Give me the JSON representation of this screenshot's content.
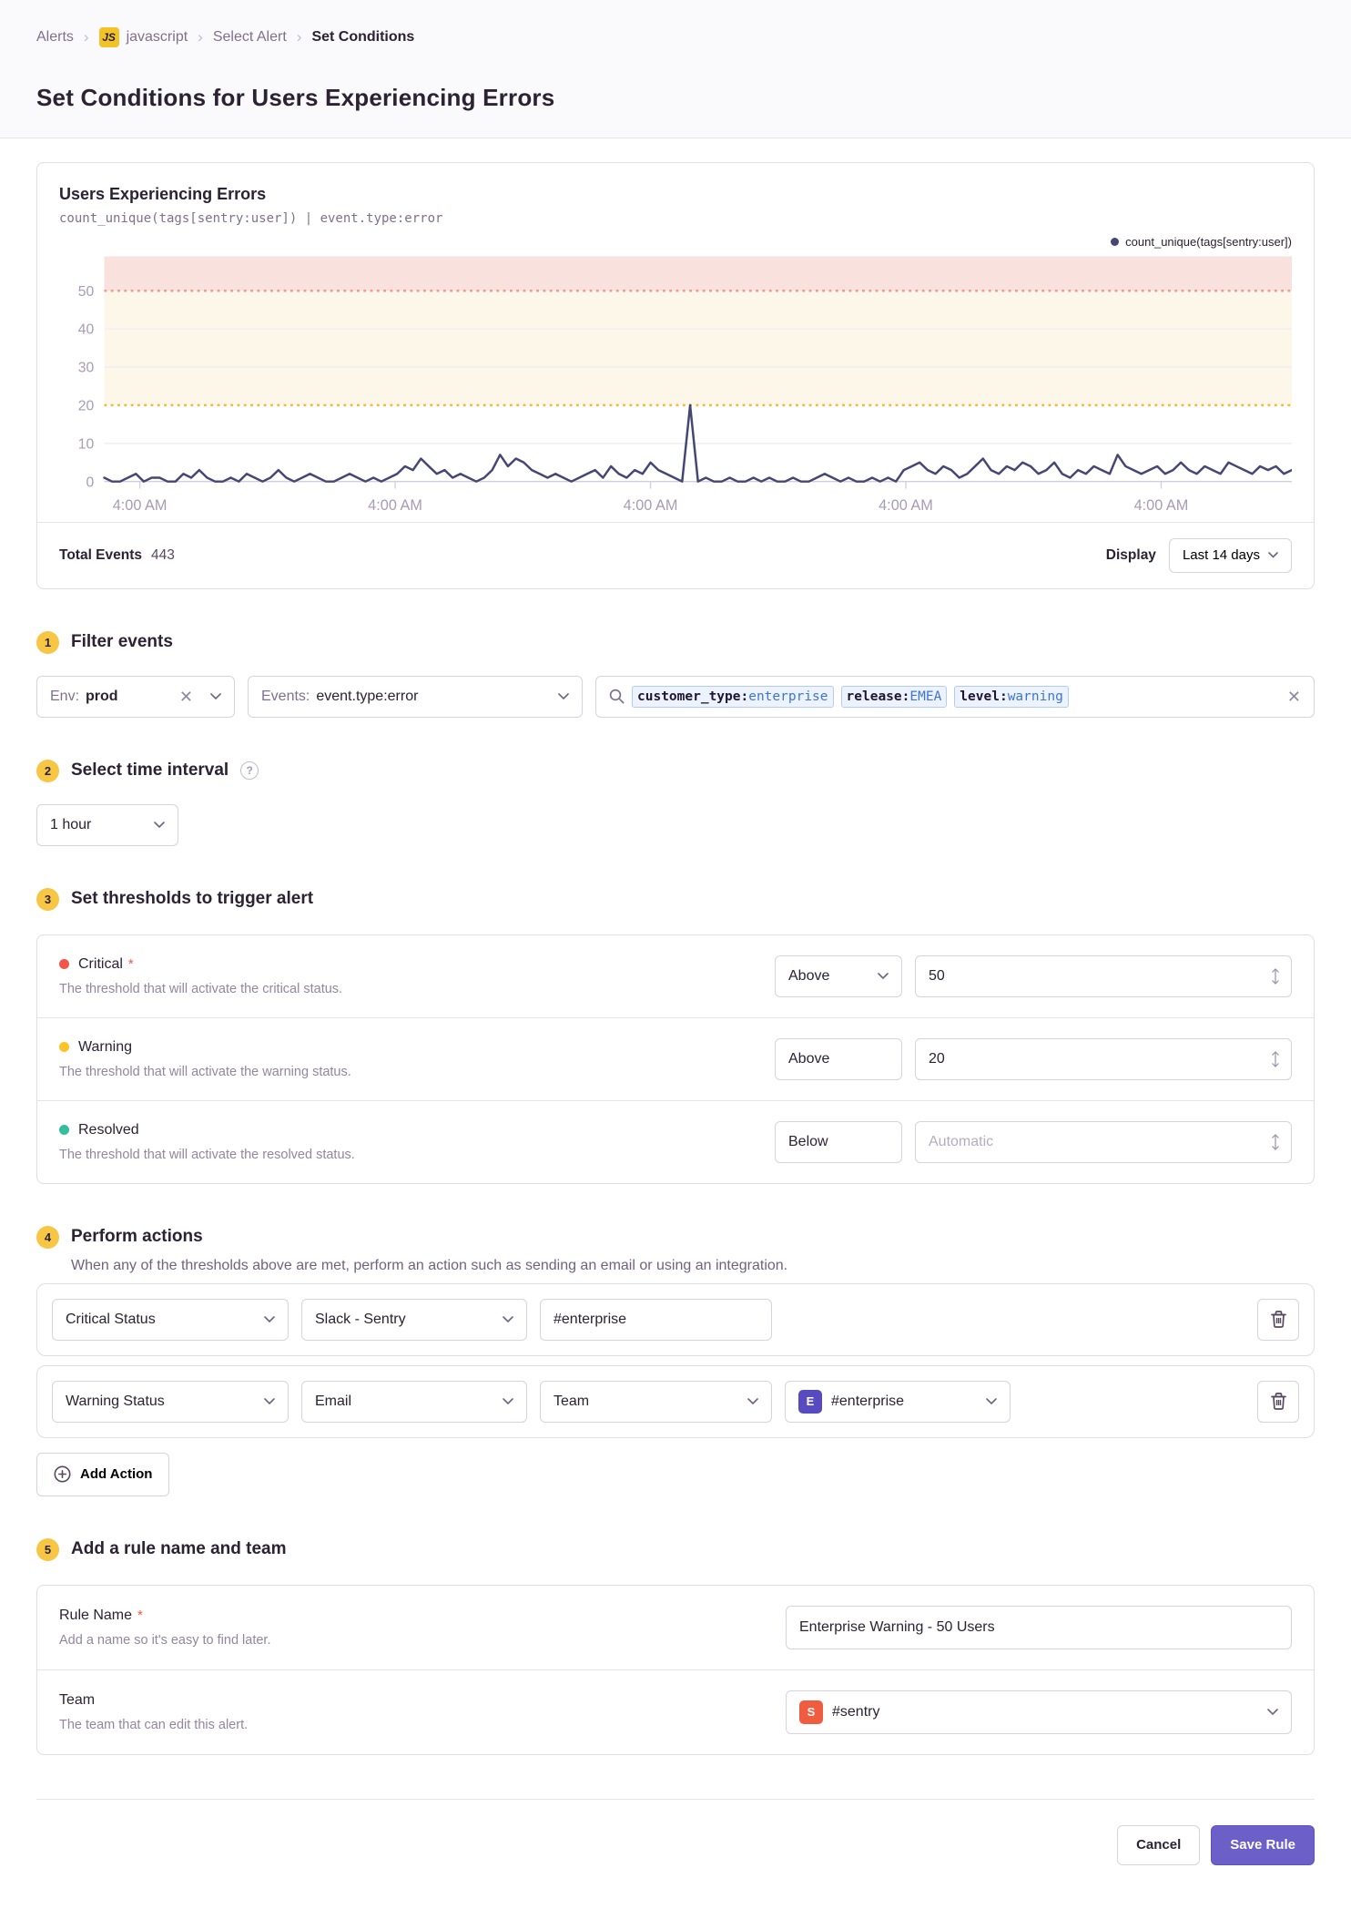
{
  "colors": {
    "accent_purple": "#6C5FC7",
    "badge_yellow": "#F6C644",
    "critical": "#F55549",
    "warning": "#FFC227",
    "resolved": "#33BF9E"
  },
  "breadcrumb": {
    "separator": "›",
    "items": [
      {
        "label": "Alerts"
      },
      {
        "label": "javascript",
        "badge": "JS"
      },
      {
        "label": "Select Alert"
      },
      {
        "label": "Set Conditions"
      }
    ]
  },
  "header": {
    "title": "Set Conditions for Users Experiencing Errors"
  },
  "chart": {
    "title": "Users Experiencing Errors",
    "query": "count_unique(tags[sentry:user])  |  event.type:error",
    "legend": "count_unique(tags[sentry:user])",
    "total_events_label": "Total Events",
    "total_events_value": "443",
    "display_label": "Display",
    "display_value": "Last 14 days"
  },
  "chart_data": {
    "type": "line",
    "title": "Users Experiencing Errors",
    "ylabel": "",
    "xlabel": "",
    "ylim": [
      0,
      59
    ],
    "yticks": [
      0,
      10,
      20,
      30,
      40,
      50
    ],
    "x_tick_labels": [
      "4:00 AM",
      "4:00 AM",
      "4:00 AM",
      "4:00 AM",
      "4:00 AM"
    ],
    "x_tick_fractions": [
      0.03,
      0.245,
      0.46,
      0.675,
      0.89
    ],
    "thresholds": {
      "critical": 50,
      "warning": 20
    },
    "legend_position": "top-right",
    "grid": true,
    "series": [
      {
        "name": "count_unique(tags[sentry:user])",
        "values": [
          1,
          0,
          0,
          1,
          2,
          0,
          1,
          1,
          0,
          0,
          2,
          1,
          3,
          1,
          0,
          0,
          1,
          0,
          2,
          1,
          0,
          1,
          3,
          1,
          0,
          1,
          2,
          1,
          0,
          0,
          1,
          2,
          1,
          0,
          1,
          0,
          1,
          2,
          4,
          3,
          6,
          4,
          2,
          3,
          1,
          2,
          1,
          0,
          1,
          3,
          7,
          4,
          6,
          5,
          3,
          2,
          1,
          2,
          1,
          0,
          1,
          2,
          3,
          1,
          4,
          2,
          1,
          3,
          2,
          5,
          3,
          2,
          1,
          0,
          20,
          0,
          1,
          0,
          0,
          1,
          0,
          0,
          1,
          0,
          1,
          0,
          0,
          1,
          0,
          0,
          1,
          2,
          1,
          0,
          1,
          0,
          0,
          1,
          0,
          1,
          0,
          3,
          4,
          5,
          3,
          2,
          4,
          3,
          1,
          2,
          4,
          6,
          3,
          2,
          4,
          3,
          5,
          4,
          2,
          3,
          5,
          2,
          1,
          3,
          2,
          4,
          3,
          2,
          7,
          4,
          3,
          2,
          3,
          4,
          2,
          3,
          5,
          3,
          2,
          4,
          3,
          2,
          5,
          4,
          3,
          2,
          4,
          3,
          4,
          2,
          3
        ]
      }
    ],
    "colors": {
      "line": "#444674",
      "critical_band": "#F9E2DD",
      "critical_line": "#F1978D",
      "warning_band": "#FDF7EA",
      "warning_line": "#F2B73B",
      "grid": "#F2EEF5",
      "axis": "#D4CDDD",
      "tick_label": "#A89BB5"
    }
  },
  "filters": {
    "section_number": "1",
    "section_title": "Filter events",
    "env": {
      "prefix": "Env:",
      "value": "prod"
    },
    "events": {
      "prefix": "Events:",
      "value": "event.type:error"
    },
    "search": {
      "tokens": [
        {
          "key": "customer_type:",
          "value": "enterprise"
        },
        {
          "key": "release:",
          "value": "EMEA"
        },
        {
          "key": "level:",
          "value": "warning"
        }
      ]
    }
  },
  "interval": {
    "section_number": "2",
    "section_title": "Select time interval",
    "help": "?",
    "value": "1 hour"
  },
  "thresholds": {
    "section_number": "3",
    "section_title": "Set thresholds to trigger alert",
    "rows": [
      {
        "label": "Critical",
        "required": "*",
        "color": "#F55549",
        "description": "The threshold that will activate the critical status.",
        "operator": "Above",
        "value": "50"
      },
      {
        "label": "Warning",
        "color": "#FFC227",
        "description": "The threshold that will activate the warning status.",
        "operator": "Above",
        "value": "20"
      },
      {
        "label": "Resolved",
        "color": "#33BF9E",
        "description": "The threshold that will activate the resolved status.",
        "operator": "Below",
        "placeholder": "Automatic"
      }
    ]
  },
  "actions": {
    "section_number": "4",
    "section_title": "Perform actions",
    "description": "When any of the thresholds above are met, perform an action such as sending an email or using an integration.",
    "rows": [
      {
        "trigger": "Critical Status",
        "service": "Slack - Sentry",
        "target": "#enterprise"
      },
      {
        "trigger": "Warning Status",
        "service": "Email",
        "target_type": "Team",
        "team": {
          "avatar": "E",
          "avatar_color": "#584AC0",
          "value": "#enterprise"
        }
      }
    ],
    "add_label": "Add Action"
  },
  "rule": {
    "section_number": "5",
    "section_title": "Add a rule name and team",
    "name": {
      "label": "Rule Name",
      "required": "*",
      "description": "Add a name so it's easy to find later.",
      "value": "Enterprise Warning - 50 Users"
    },
    "team": {
      "label": "Team",
      "description": "The team that can edit this alert.",
      "avatar": "S",
      "avatar_color": "#F05C3F",
      "value": "#sentry"
    }
  },
  "footer": {
    "cancel": "Cancel",
    "save": "Save Rule"
  }
}
